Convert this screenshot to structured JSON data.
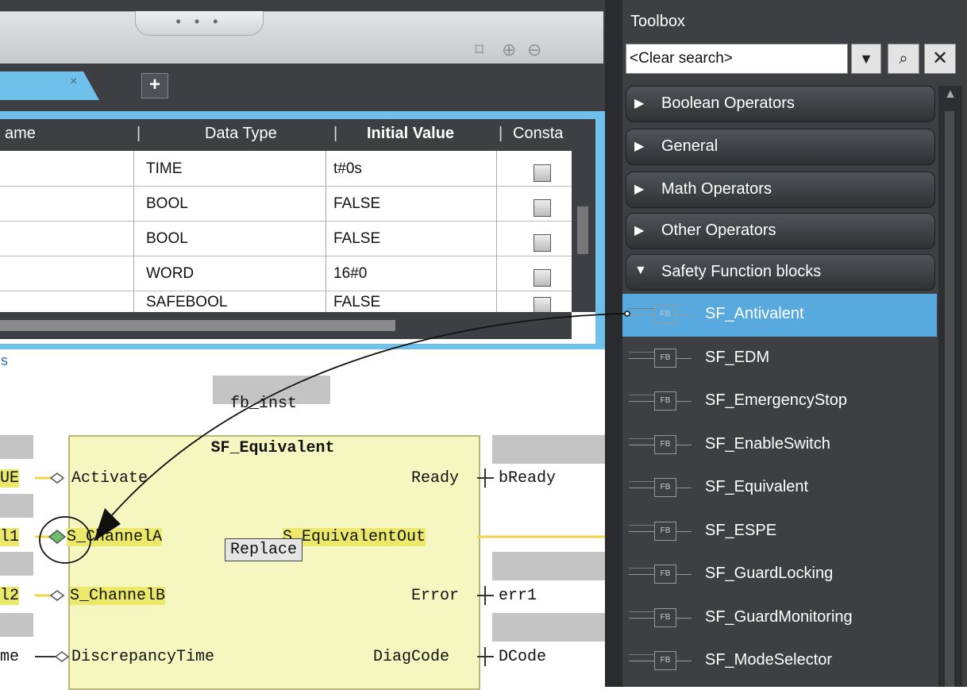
{
  "toolbar": {
    "grip": "• • •",
    "fit_icon": "⌑",
    "zoom_in_icon": "⊕",
    "zoom_out_icon": "⊖"
  },
  "tabs": {
    "close": "×",
    "add": "+"
  },
  "variables": {
    "headers": {
      "name": "ame",
      "data_type": "Data Type",
      "initial_value": "Initial Value",
      "constant": "Consta"
    },
    "rows": [
      {
        "type": "TIME",
        "initial": "t#0s"
      },
      {
        "type": "BOOL",
        "initial": "FALSE"
      },
      {
        "type": "BOOL",
        "initial": "FALSE"
      },
      {
        "type": "WORD",
        "initial": "16#0"
      },
      {
        "type": "SAFEBOOL",
        "initial": "FALSE"
      }
    ]
  },
  "diagram": {
    "section_label": "s",
    "instance": "fb_inst",
    "block_name": "SF_Equivalent",
    "inputs": {
      "activate": "Activate",
      "channel_a": "S_ChannelA",
      "channel_b": "S_ChannelB",
      "discrepancy": "DiscrepancyTime"
    },
    "outputs": {
      "ready": "Ready",
      "equivalent_out": "S_EquivalentOut",
      "error": "Error",
      "diag": "DiagCode"
    },
    "input_vars": {
      "activate": "UE",
      "channel_a": "l1",
      "channel_b": "l2",
      "discrepancy": "me"
    },
    "output_vars": {
      "ready": "bReady",
      "error": "err1",
      "diag": "DCode"
    },
    "tooltip": "Replace"
  },
  "toolbox": {
    "title": "Toolbox",
    "search_value": "<Clear search>",
    "dropdown_icon": "▼",
    "find_icon": "⌕",
    "clear_icon": "✕",
    "categories": [
      {
        "label": "Boolean Operators",
        "arrow": "▶"
      },
      {
        "label": "General",
        "arrow": "▶"
      },
      {
        "label": "Math Operators",
        "arrow": "▶"
      },
      {
        "label": "Other Operators",
        "arrow": "▶"
      },
      {
        "label": "Safety Function blocks",
        "arrow": "▼"
      }
    ],
    "fb_icon_label": "FB",
    "items": [
      "SF_Antivalent",
      "SF_EDM",
      "SF_EmergencyStop",
      "SF_EnableSwitch",
      "SF_Equivalent",
      "SF_ESPE",
      "SF_GuardLocking",
      "SF_GuardMonitoring",
      "SF_ModeSelector"
    ],
    "selected_index": 0,
    "scroll_up_icon": "▲"
  },
  "colors": {
    "selection": "#58a9de",
    "tab_active": "#6fc0ea",
    "fb_fill": "#f6f6c0",
    "highlight": "#ece96a",
    "wire": "#f0d54a"
  }
}
